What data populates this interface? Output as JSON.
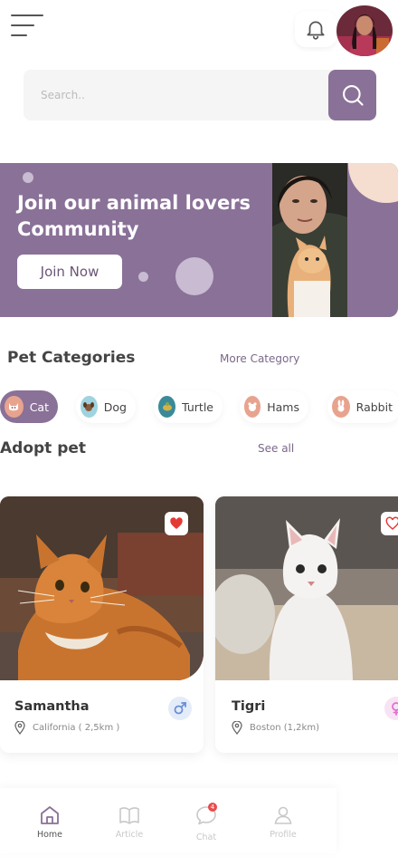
{
  "header": {
    "menu_icon": "hamburger-menu-icon",
    "notification_icon": "bell-icon",
    "avatar_alt": "user-avatar"
  },
  "search": {
    "placeholder": "Search..",
    "button_icon": "search-icon"
  },
  "banner": {
    "title": "Join our animal lovers Community",
    "button_label": "Join Now"
  },
  "categories": {
    "title": "Pet Categories",
    "more_label": "More Category",
    "items": [
      {
        "label": "Cat",
        "icon": "cat-icon",
        "active": true
      },
      {
        "label": "Dog",
        "icon": "dog-icon",
        "active": false
      },
      {
        "label": "Turtle",
        "icon": "turtle-icon",
        "active": false
      },
      {
        "label": "Hams",
        "icon": "hamster-icon",
        "active": false
      },
      {
        "label": "Rabbit",
        "icon": "rabbit-icon",
        "active": false
      }
    ]
  },
  "adopt": {
    "title": "Adopt pet",
    "see_all_label": "See all",
    "pets": [
      {
        "name": "Samantha",
        "location": "California ( 2,5km )",
        "gender": "male",
        "favorite": true
      },
      {
        "name": "Tigri",
        "location": "Boston (1,2km)",
        "gender": "female",
        "favorite": false
      }
    ]
  },
  "nav": {
    "items": [
      {
        "label": "Home",
        "icon": "home-icon",
        "active": true
      },
      {
        "label": "Article",
        "icon": "book-icon",
        "active": false
      },
      {
        "label": "Chat",
        "icon": "chat-icon",
        "active": false,
        "badge": "4"
      },
      {
        "label": "Profile",
        "icon": "profile-icon",
        "active": false
      }
    ]
  },
  "colors": {
    "accent": "#8a7198",
    "accent_light": "#c8bbd2",
    "banner_circle": "#f5ddd0",
    "heart": "#e53935",
    "male": "#6b8fd6",
    "female": "#e070d0"
  }
}
